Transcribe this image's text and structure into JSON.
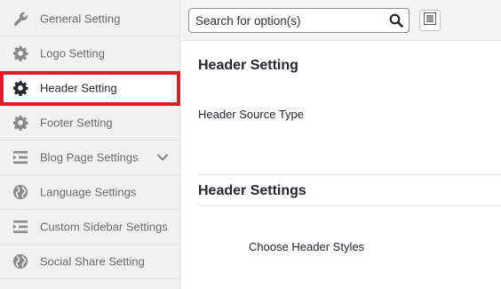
{
  "sidebar": {
    "items": [
      {
        "label": "General Setting",
        "icon": "wrench-icon"
      },
      {
        "label": "Logo Setting",
        "icon": "gear-icon"
      },
      {
        "label": "Header Setting",
        "icon": "gear-icon",
        "active": true
      },
      {
        "label": "Footer Setting",
        "icon": "gear-icon"
      },
      {
        "label": "Blog Page Settings",
        "icon": "list-icon",
        "expandable": true
      },
      {
        "label": "Language Settings",
        "icon": "globe-icon"
      },
      {
        "label": "Custom Sidebar Settings",
        "icon": "list-icon"
      },
      {
        "label": "Social Share Setting",
        "icon": "globe-icon"
      }
    ]
  },
  "search": {
    "placeholder": "Search for option(s)"
  },
  "main": {
    "section1": {
      "title": "Header Setting",
      "field_label": "Header Source Type"
    },
    "section2": {
      "title": "Header Settings",
      "field_label": "Choose Header Styles"
    }
  },
  "colors": {
    "active_outline": "#e01e2b",
    "sidebar_bg": "#f1f1f1",
    "icon_gray": "#8a8a8a"
  }
}
